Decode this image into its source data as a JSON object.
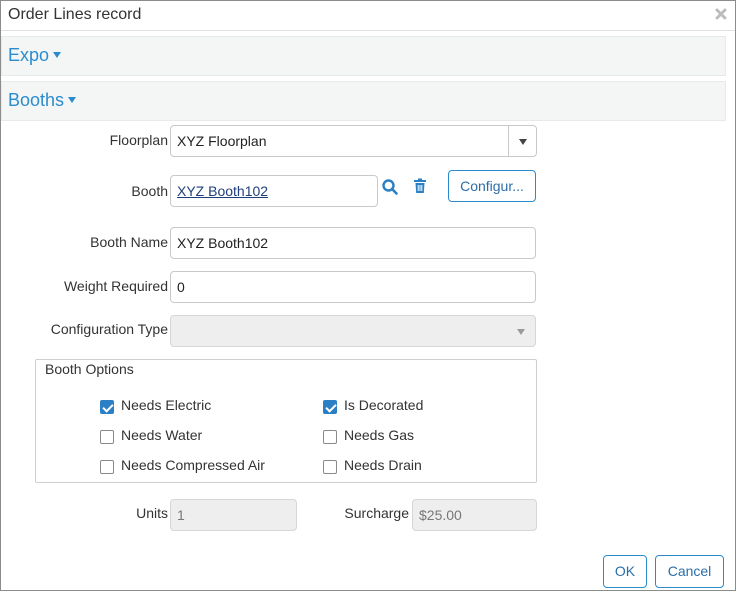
{
  "window": {
    "title": "Order Lines record",
    "close_icon": "close-icon"
  },
  "sections": {
    "expo": "Expo",
    "booths": "Booths"
  },
  "form": {
    "floorplan": {
      "label": "Floorplan",
      "value": "XYZ Floorplan"
    },
    "booth": {
      "label": "Booth",
      "value": "XYZ Booth102",
      "configure_label": "Configur..."
    },
    "booth_name": {
      "label": "Booth Name",
      "value": "XYZ Booth102"
    },
    "weight_required": {
      "label": "Weight Required",
      "value": "0"
    },
    "configuration_type": {
      "label": "Configuration Type",
      "value": ""
    },
    "booth_options": {
      "legend": "Booth Options",
      "items": [
        {
          "label": "Needs Electric",
          "checked": true
        },
        {
          "label": "Is Decorated",
          "checked": true
        },
        {
          "label": "Needs Water",
          "checked": false
        },
        {
          "label": "Needs Gas",
          "checked": false
        },
        {
          "label": "Needs Compressed Air",
          "checked": false
        },
        {
          "label": "Needs Drain",
          "checked": false
        }
      ]
    },
    "units": {
      "label": "Units",
      "value": "1"
    },
    "surcharge": {
      "label": "Surcharge",
      "value": "$25.00"
    }
  },
  "footer": {
    "ok_label": "OK",
    "cancel_label": "Cancel"
  },
  "colors": {
    "accent": "#2b8ccd",
    "checkbox_checked": "#2b7fc4",
    "section_bg": "#f4f6f6"
  }
}
